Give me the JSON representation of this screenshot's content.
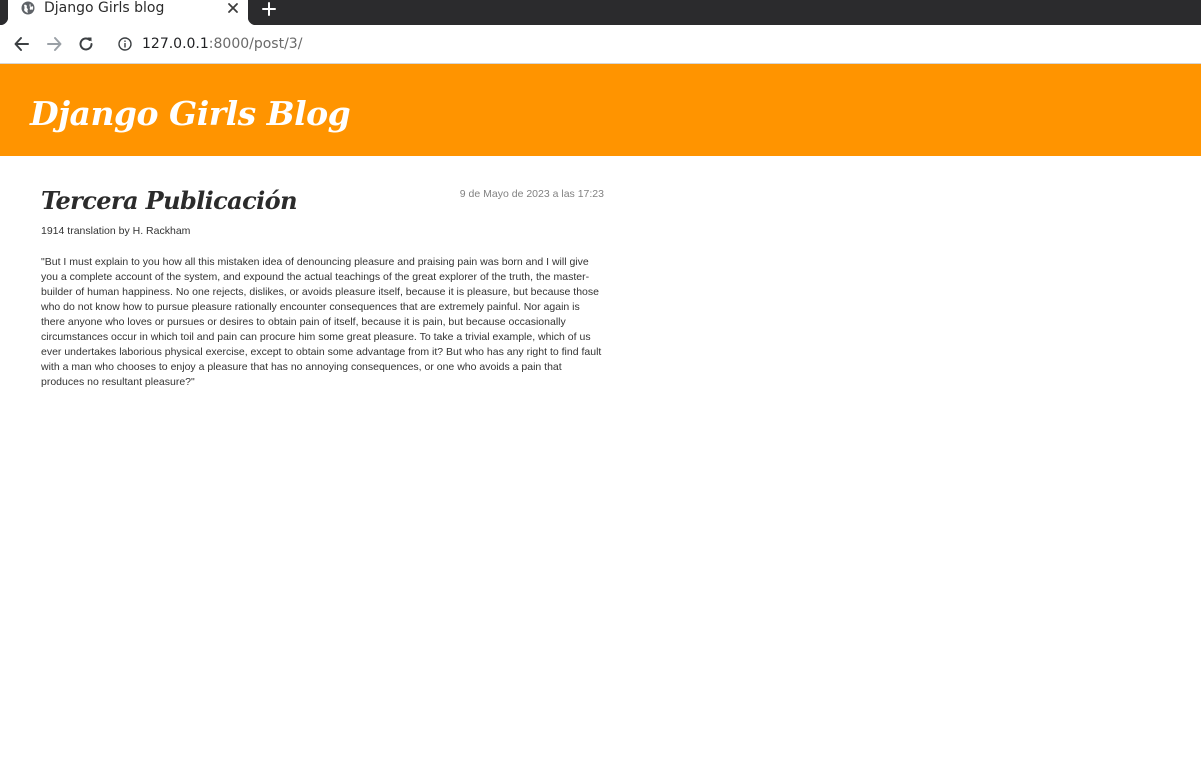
{
  "browser": {
    "tab": {
      "title": "Django Girls blog"
    },
    "address": {
      "host": "127.0.0.1",
      "rest": ":8000/post/3/"
    }
  },
  "header": {
    "blog_title": "Django Girls Blog",
    "background_color": "#ff9400"
  },
  "post": {
    "date": "9 de Mayo de 2023 a las 17:23",
    "title": "Tercera Publicación",
    "subtitle": "1914 translation by H. Rackham",
    "body": "\"But I must explain to you how all this mistaken idea of denouncing pleasure and praising pain was born and I will give you a complete account of the system, and expound the actual teachings of the great explorer of the truth, the master-builder of human happiness. No one rejects, dislikes, or avoids pleasure itself, because it is pleasure, but because those who do not know how to pursue pleasure rationally encounter consequences that are extremely painful. Nor again is there anyone who loves or pursues or desires to obtain pain of itself, because it is pain, but because occasionally circumstances occur in which toil and pain can procure him some great pleasure. To take a trivial example, which of us ever undertakes laborious physical exercise, except to obtain some advantage from it? But who has any right to find fault with a man who chooses to enjoy a pleasure that has no annoying consequences, or one who avoids a pain that produces no resultant pleasure?\""
  },
  "icons": {
    "favicon": "globe-icon",
    "tab_close": "close-icon",
    "new_tab": "plus-icon",
    "back": "arrow-left-icon",
    "forward": "arrow-right-icon",
    "reload": "reload-icon",
    "site_info": "info-icon"
  }
}
